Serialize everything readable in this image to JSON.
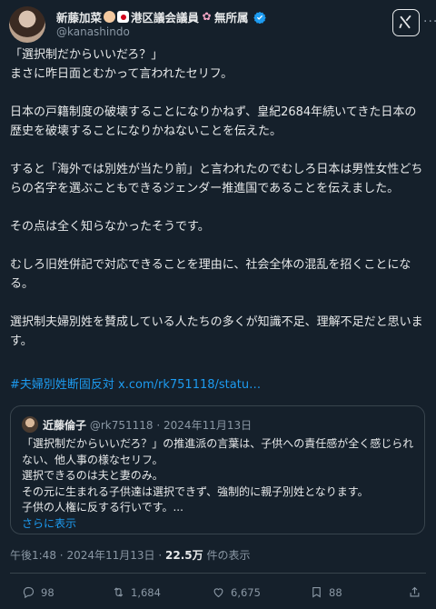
{
  "author": {
    "display_name": "新藤加菜",
    "name_suffix": "港区議会議員",
    "name_suffix2": "無所属",
    "handle": "@kanashindo"
  },
  "tweet": {
    "paragraphs": [
      "「選択制だからいいだろ？」\nまさに昨日面とむかって言われたセリフ。",
      "日本の戸籍制度の破壊することになりかねず、皇紀2684年続いてきた日本の歴史を破壊することになりかねないことを伝えた。",
      "すると「海外では別姓が当たり前」と言われたのでむしろ日本は男性女性どちらの名字を選ぶこともできるジェンダー推進国であることを伝えました。",
      "その点は全く知らなかったそうです。",
      "むしろ旧姓併記で対応できることを理由に、社会全体の混乱を招くことになる。",
      "選択制夫婦別姓を賛成している人たちの多くが知識不足、理解不足だと思います。"
    ],
    "hashtag": "#夫婦別姓断固反対",
    "link": "x.com/rk751118/statu…"
  },
  "quote": {
    "name": "近藤倫子",
    "handle": "@rk751118",
    "sep": "·",
    "date": "2024年11月13日",
    "lines": [
      "「選択制だからいいだろ？」の推進派の言葉は、子供への責任感が全く感じられない、他人事の様なセリフ。",
      "選択できるのは夫と妻のみ。",
      "その元に生まれる子供達は選択できず、強制的に親子別姓となります。",
      "子供の人権に反する行いです。..."
    ],
    "show_more": "さらに表示"
  },
  "meta": {
    "time": "午後1:48",
    "sep": "·",
    "date": "2024年11月13日",
    "sep2": "·",
    "views_count": "22.5万",
    "views_label": "件の表示"
  },
  "actions": {
    "replies": "98",
    "reposts": "1,684",
    "likes": "6,675",
    "bookmarks": "88"
  },
  "colors": {
    "background": "#15202b",
    "text": "#e7e9ea",
    "muted": "#8b98a5",
    "link": "#1d9bf0",
    "border": "#38444d",
    "verified": "#1d9bf0"
  }
}
